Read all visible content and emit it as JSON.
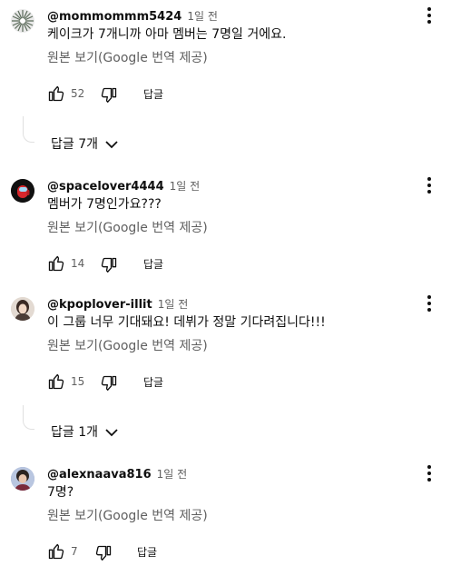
{
  "labels": {
    "translate": "원본 보기(Google 번역 제공)",
    "reply": "답글"
  },
  "comments": [
    {
      "author": "@mommommm5424",
      "time": "1일 전",
      "text": "케이크가 7개니까 아마 멤버는 7명일 거에요.",
      "likes": "52"
    },
    {
      "author": "@spacelover4444",
      "time": "1일 전",
      "text": "멤버가 7명인가요???",
      "likes": "14"
    },
    {
      "author": "@kpoplover-illit",
      "time": "1일 전",
      "text": "이 그룹 너무 기대돼요! 데뷔가 정말 기다려집니다!!!",
      "likes": "15"
    },
    {
      "author": "@alexnaava816",
      "time": "1일 전",
      "text": "7명?",
      "likes": "7"
    }
  ],
  "reply_toggles": [
    {
      "label": "답글 7개"
    },
    {
      "label": "답글 1개"
    }
  ],
  "colors": {
    "text": "#0f0f0f",
    "secondary": "#606060",
    "thread": "#e0e0e0"
  },
  "icons": [
    "like-icon",
    "dislike-icon",
    "more-vert-icon",
    "chevron-down-icon"
  ]
}
